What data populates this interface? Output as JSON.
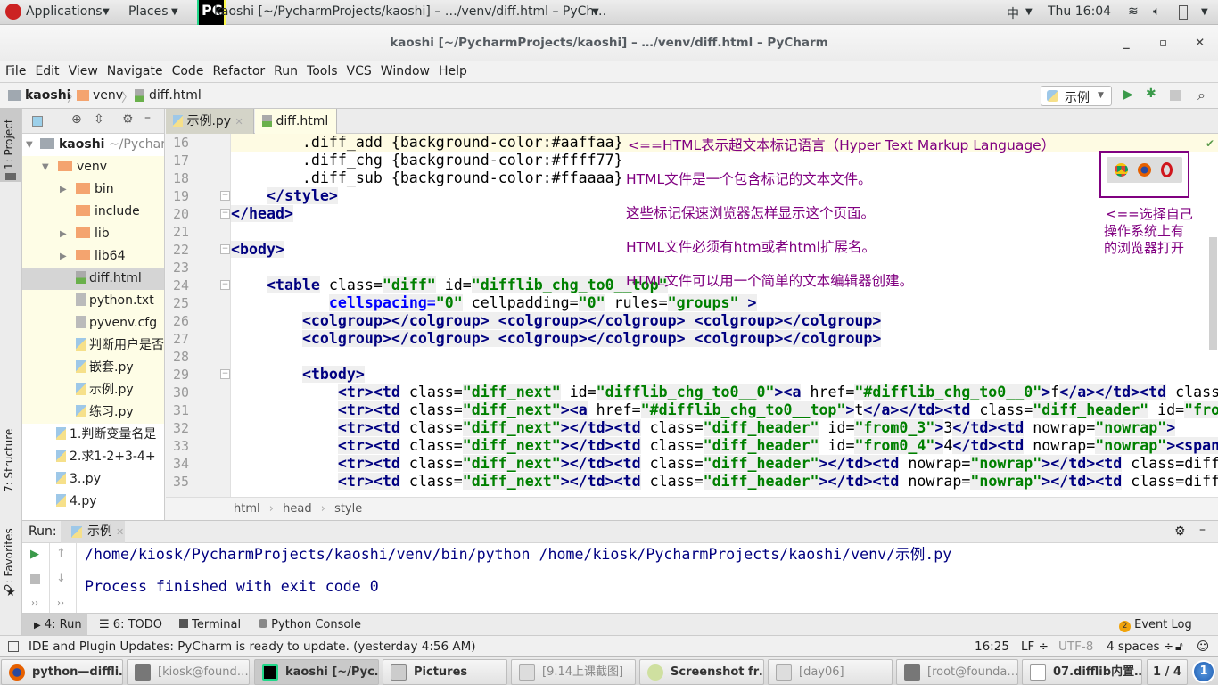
{
  "topbar": {
    "applications": "Applications",
    "places": "Places",
    "window_title": "kaoshi [~/PycharmProjects/kaoshi] – …/venv/diff.html – PyCh…",
    "input_method": "中",
    "clock": "Thu 16:04"
  },
  "window": {
    "title": "kaoshi [~/PycharmProjects/kaoshi] – …/venv/diff.html – PyCharm"
  },
  "menu": [
    "File",
    "Edit",
    "View",
    "Navigate",
    "Code",
    "Refactor",
    "Run",
    "Tools",
    "VCS",
    "Window",
    "Help"
  ],
  "nav": {
    "crumbs": [
      "kaoshi",
      "venv",
      "diff.html"
    ],
    "run_config": "示例"
  },
  "sidebar": {
    "project_label": "1: Project",
    "structure_label": "7: Structure",
    "favorites_label": "2: Favorites"
  },
  "project_tree": [
    {
      "label": "kaoshi",
      "extra": "~/Pycharm",
      "type": "root"
    },
    {
      "label": "venv",
      "type": "folder"
    },
    {
      "label": "bin",
      "type": "folder"
    },
    {
      "label": "include",
      "type": "folder"
    },
    {
      "label": "lib",
      "type": "folder"
    },
    {
      "label": "lib64",
      "type": "folder"
    },
    {
      "label": "diff.html",
      "type": "html"
    },
    {
      "label": "python.txt",
      "type": "text"
    },
    {
      "label": "pyvenv.cfg",
      "type": "text"
    },
    {
      "label": "判断用户是否",
      "type": "py"
    },
    {
      "label": "嵌套.py",
      "type": "py"
    },
    {
      "label": "示例.py",
      "type": "py"
    },
    {
      "label": "练习.py",
      "type": "py"
    },
    {
      "label": "1.判断变量名是",
      "type": "py"
    },
    {
      "label": "2.求1-2+3-4+",
      "type": "py"
    },
    {
      "label": "3..py",
      "type": "py"
    },
    {
      "label": "4.py",
      "type": "py"
    }
  ],
  "tabs": [
    {
      "label": "示例.py",
      "active": false
    },
    {
      "label": "diff.html",
      "active": true
    }
  ],
  "code": {
    "first_line": 16,
    "lines": [
      "        .diff_add {background-color:#aaffaa}",
      "        .diff_chg {background-color:#ffff77}",
      "        .diff_sub {background-color:#ffaaaa}",
      "    </style>",
      "</head>",
      "",
      "<body>",
      "",
      "    <table class=\"diff\" id=\"difflib_chg_to0__top\"",
      "           cellspacing=\"0\" cellpadding=\"0\" rules=\"groups\" >",
      "        <colgroup></colgroup> <colgroup></colgroup> <colgroup></colgroup>",
      "        <colgroup></colgroup> <colgroup></colgroup> <colgroup></colgroup>",
      "",
      "        <tbody>",
      "            <tr><td class=\"diff_next\" id=\"difflib_chg_to0__0\"><a href=\"#difflib_chg_to0__0\">f</a></td><td class=\"diff_header\"",
      "            <tr><td class=\"diff_next\"><a href=\"#difflib_chg_to0__top\">t</a></td><td class=\"diff_header\" id=\"from0_1\"",
      "            <tr><td class=\"diff_next\"></td><td class=\"diff_header\" id=\"from0_3\">3</td><td nowrap=\"nowrap\">",
      "            <tr><td class=\"diff_next\"></td><td class=\"diff_header\" id=\"from0_4\">4</td><td nowrap=\"nowrap\"><span",
      "            <tr><td class=\"diff_next\"></td><td class=\"diff_header\"></td><td nowrap=\"nowrap\"></td><td class=\"diff",
      "            <tr><td class=\"diff_next\"></td><td class=\"diff_header\"></td><td nowrap=\"nowrap\"></td><td class=\"diff"
    ]
  },
  "annotations": {
    "notes": [
      "<==HTML表示超文本标记语言（Hyper Text Markup Language）",
      "HTML文件是一个包含标记的文本文件。",
      "这些标记保速浏览器怎样显示这个页面。",
      "HTML文件必须有htm或者html扩展名。",
      "HTML文件可以用一个简单的文本编辑器创建。"
    ],
    "browser_hint": [
      "<==选择自己",
      "操作系统上有",
      "的浏览器打开"
    ],
    "color": "#800080"
  },
  "editor_breadcrumb": [
    "html",
    "head",
    "style"
  ],
  "run": {
    "label": "Run:",
    "tab": "示例",
    "output": [
      "/home/kiosk/PycharmProjects/kaoshi/venv/bin/python /home/kiosk/PycharmProjects/kaoshi/venv/示例.py",
      "",
      "Process finished with exit code 0"
    ]
  },
  "tool_buttons": [
    "4: Run",
    "6: TODO",
    "Terminal",
    "Python Console"
  ],
  "event_log": {
    "count": "2",
    "label": "Event Log"
  },
  "status": {
    "message": "IDE and Plugin Updates: PyCharm is ready to update. (yesterday 4:56 AM)",
    "position": "16:25",
    "line_sep": "LF ÷",
    "encoding": "UTF-8",
    "indent": "4 spaces ÷"
  },
  "taskbar": {
    "items": [
      "python—diffli…",
      "[kiosk@found…",
      "kaoshi [~/Pyc…",
      "Pictures",
      "[9.14上课截图]",
      "Screenshot fr…",
      "[day06]",
      "[root@founda…",
      "07.difflib内置…"
    ],
    "workspace": "1 / 4",
    "badge": "1"
  }
}
